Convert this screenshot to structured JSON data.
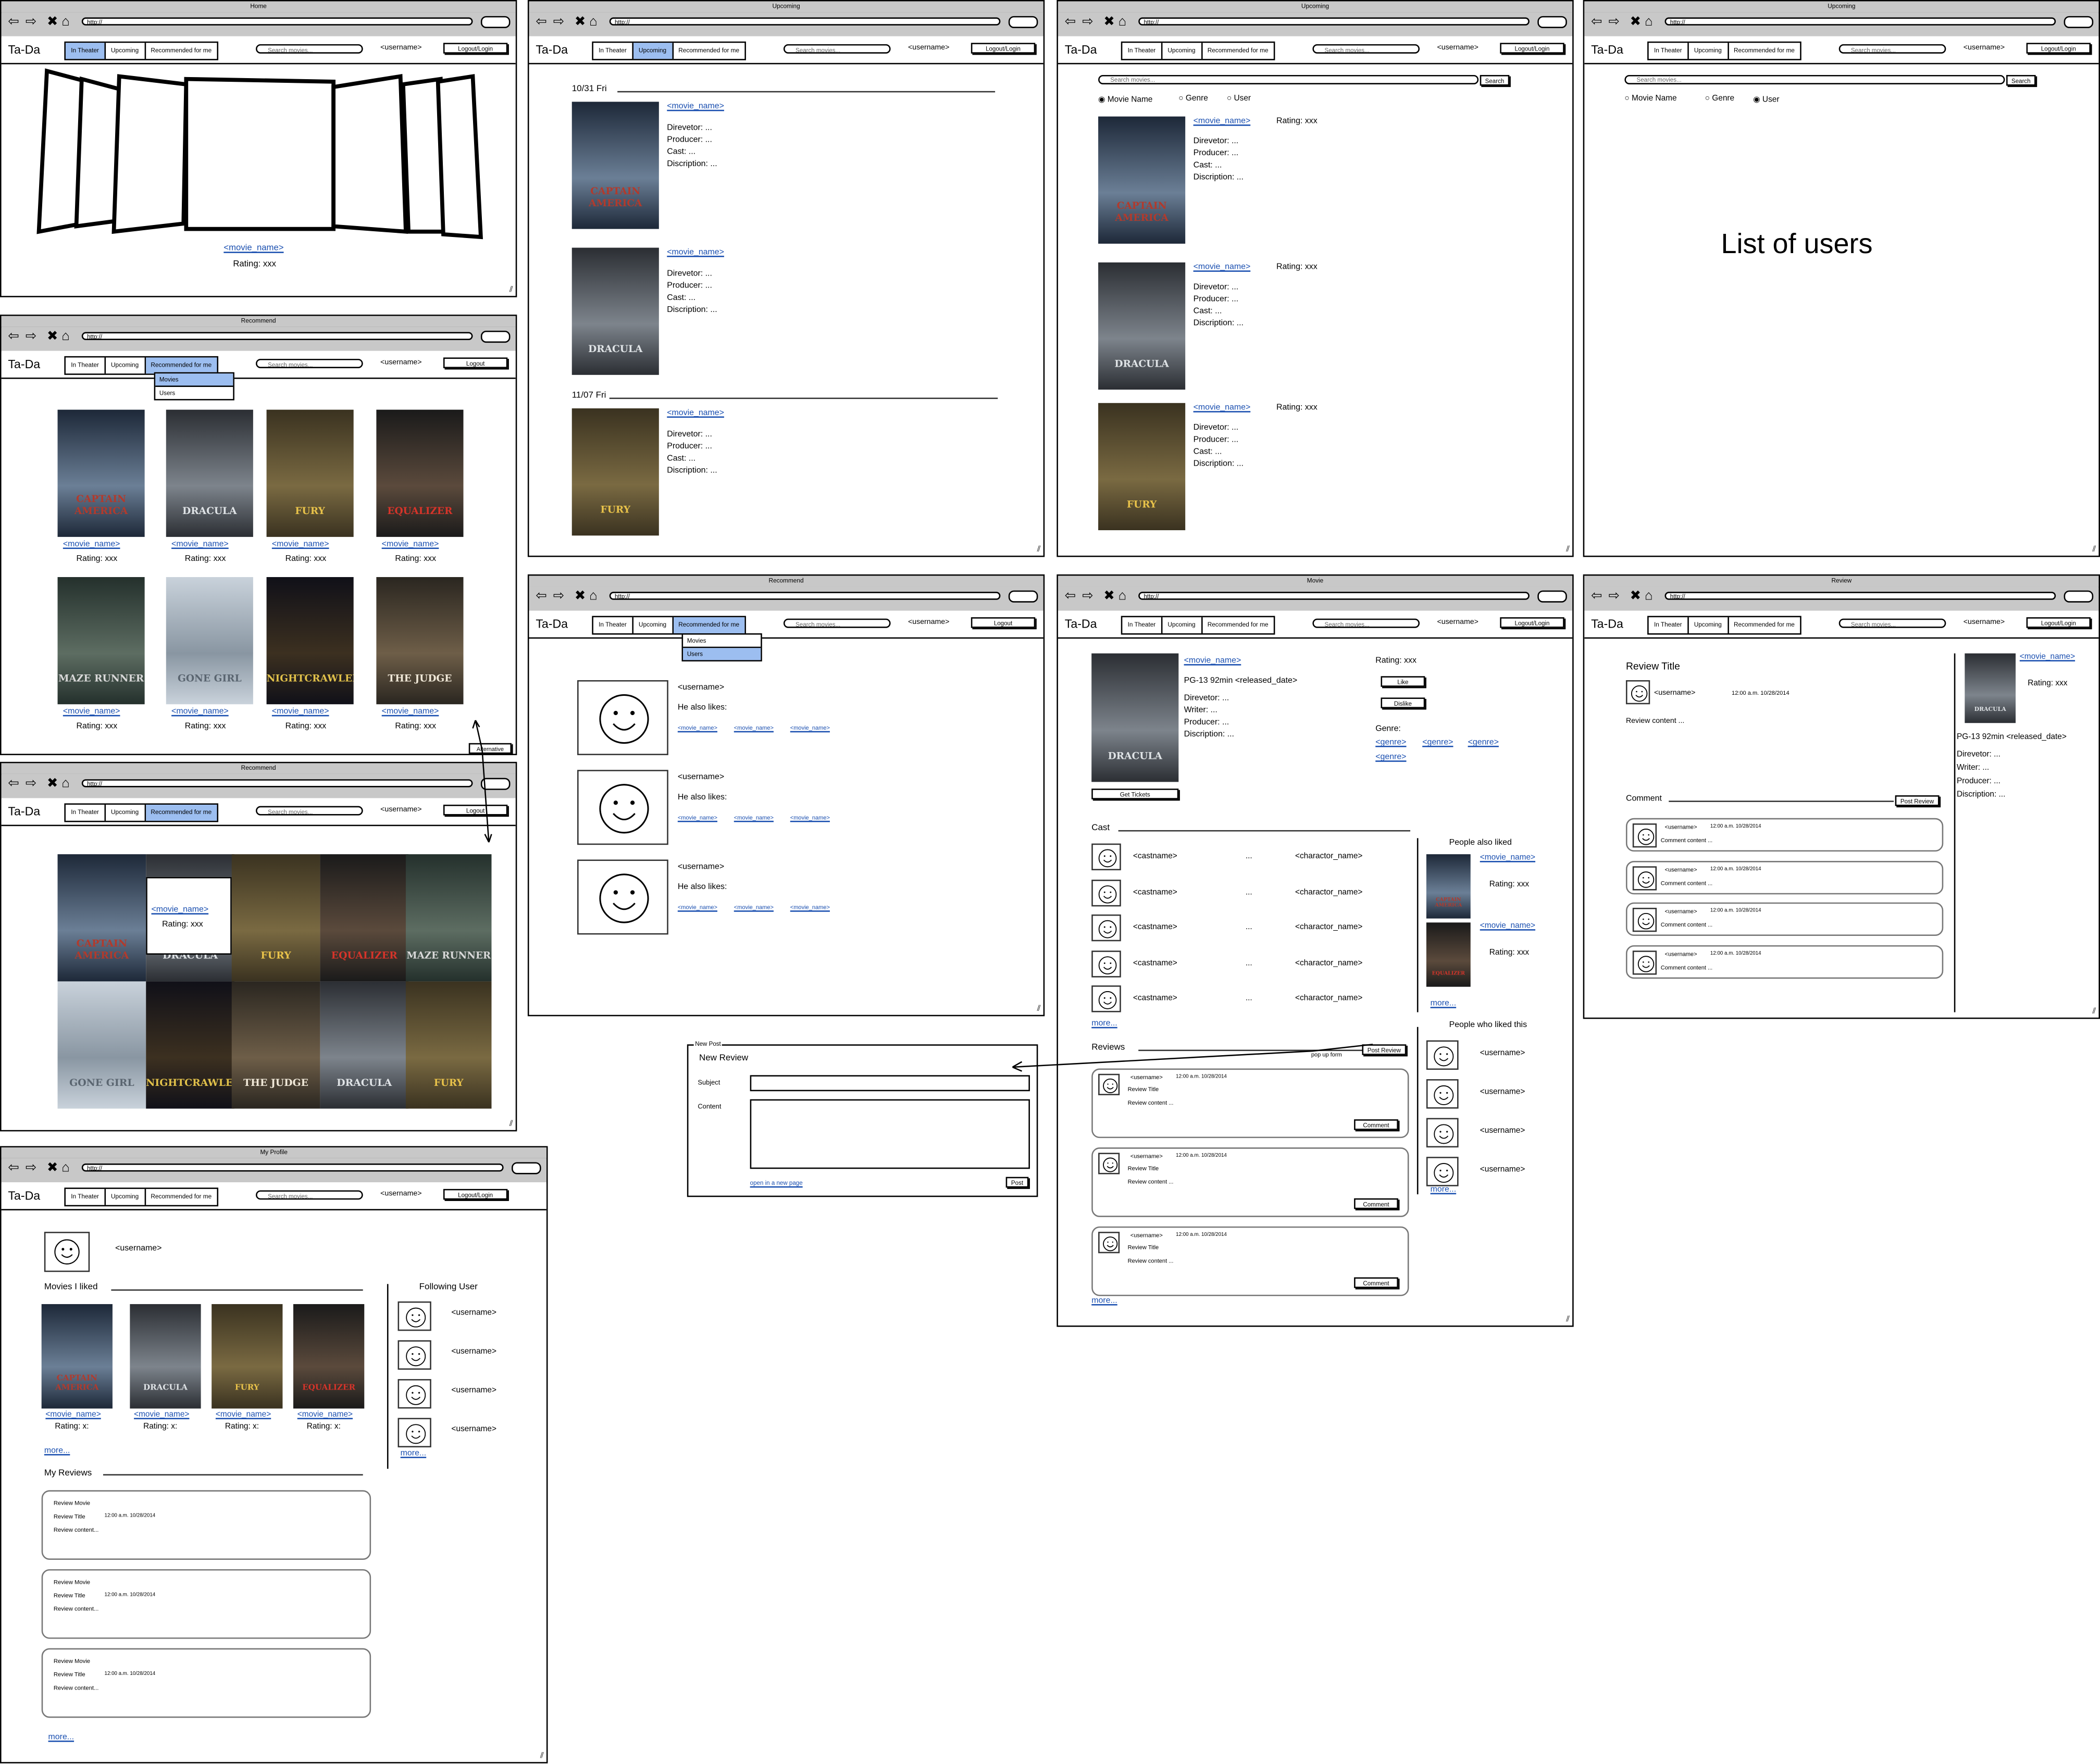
{
  "common": {
    "url": "http://",
    "brand": "Ta-Da",
    "tab_in_theater": "In Theater",
    "tab_upcoming": "Upcoming",
    "tab_recommended": "Recommended for me",
    "search_placeholder": "Search movies...",
    "username": "<username>",
    "logout_login": "Logout/Login",
    "logout": "Logout",
    "movie_name": "<movie_name>",
    "rating_xxx": "Rating: xxx",
    "director": "Direvetor: ...",
    "producer": "Producer: ...",
    "cast": "Cast: ...",
    "description": "Discription: ...",
    "writer": "Writer: ...",
    "more": "more...",
    "search_btn": "Search",
    "username_raw": "<username>"
  },
  "posters": {
    "captain": "CAPTAIN AMERICA",
    "dracula": "DRACULA",
    "fury": "FURY",
    "equalizer": "EQUALIZER",
    "maze": "MAZE RUNNER",
    "gone": "GONE GIRL",
    "night": "NIGHTCRAWLER",
    "judge": "THE JUDGE"
  },
  "home": {
    "title": "Home",
    "rating": "Rating: xxx"
  },
  "recommend": {
    "title": "Recommend",
    "menu_movies": "Movies",
    "menu_users": "Users",
    "alternative": "Alternative"
  },
  "upcoming": {
    "title": "Upcoming",
    "date1": "10/31 Fri",
    "date2": "11/07 Fri"
  },
  "search": {
    "movie_name": "Movie Name",
    "genre": "Genre",
    "user": "User"
  },
  "list_users": "List of users",
  "users_rec": {
    "he_likes": "He also likes:"
  },
  "movie": {
    "title": "Movie",
    "rating": "PG-13 92min",
    "released": "<released_date>",
    "like": "Like",
    "dislike": "Dislike",
    "genre": "Genre:",
    "genre_tag": "<genre>",
    "get_tickets": "Get Tickets",
    "cast": "Cast",
    "castname": "<castname>",
    "dots": "...",
    "character": "<charactor_name>",
    "people_liked": "People also liked",
    "people_who": "People who liked this",
    "reviews": "Reviews",
    "post_review": "Post Review",
    "popup": "pop up form",
    "comment": "Comment",
    "review_title": "Review Title",
    "review_content": "Review content ...",
    "time": "12:00 a.m. 10/28/2014"
  },
  "review": {
    "title": "Review",
    "heading": "Review Title",
    "content": "Review content ...",
    "comment": "Comment",
    "post_review": "Post Review",
    "comment_content": "Comment content ..."
  },
  "newpost": {
    "title": "New Post",
    "heading": "New Review",
    "subject": "Subject",
    "content": "Content",
    "open": "open in a new page",
    "post": "Post"
  },
  "profile": {
    "title": "My Profile",
    "movies_liked": "Movies I liked",
    "following": "Following User",
    "rating_x": "Rating: x:",
    "my_reviews": "My Reviews",
    "review_movie": "Review Movie",
    "review_title": "Review Title",
    "time": "12:00 a.m. 10/28/2014",
    "review_content": "Review content..."
  }
}
